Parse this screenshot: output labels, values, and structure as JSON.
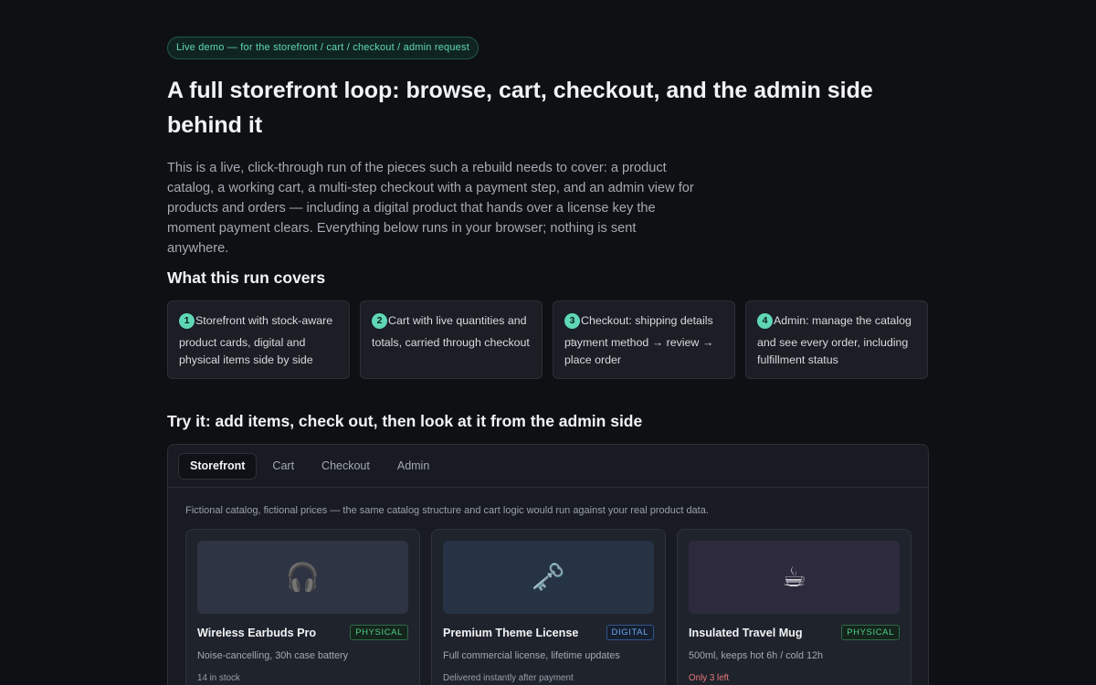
{
  "badge_text": "Live demo — for the storefront / cart / checkout / admin request",
  "title": "A full storefront loop: browse, cart, checkout, and the admin side behind it",
  "intro": "This is a live, click-through run of the pieces such a rebuild needs to cover: a product catalog, a working cart, a multi-step checkout with a payment step, and an admin view for products and orders — including a digital product that hands over a license key the moment payment clears. Everything below runs in your browser; nothing is sent anywhere.",
  "covers": {
    "heading": "What this run covers",
    "steps": [
      {
        "num": "1",
        "first": "Storefront with stock-aware",
        "rest": "product cards, digital and physical items side by side"
      },
      {
        "num": "2",
        "first": "Cart with live quantities and",
        "rest": "totals, carried through checkout"
      },
      {
        "num": "3",
        "first": "Checkout: shipping details →",
        "rest": "payment method → review → place order"
      },
      {
        "num": "4",
        "first": "Admin: manage the catalog",
        "rest": "and see every order, including fulfillment status"
      }
    ]
  },
  "try_heading": "Try it: add items, check out, then look at it from the admin side",
  "tabs": [
    "Storefront",
    "Cart",
    "Checkout",
    "Admin"
  ],
  "active_tab": "Storefront",
  "catalog_note": "Fictional catalog, fictional prices — the same catalog structure and cart logic would run against your real product data.",
  "products": [
    {
      "icon": "headphones-icon",
      "glyph": "🎧",
      "thumb_color": "#2f3444",
      "name": "Wireless Earbuds Pro",
      "type": "PHYSICAL",
      "desc": "Noise-cancelling, 30h case battery",
      "stock": "14 in stock"
    },
    {
      "icon": "key-icon",
      "glyph": "🗝️",
      "thumb_color": "#263344",
      "name": "Premium Theme License",
      "type": "DIGITAL",
      "desc": "Full commercial license, lifetime updates",
      "stock": "Delivered instantly after payment"
    },
    {
      "icon": "coffee-cup-icon",
      "glyph": "☕",
      "thumb_color": "#2e2a3e",
      "name": "Insulated Travel Mug",
      "type": "PHYSICAL",
      "desc": "500ml, keeps hot 6h / cold 12h",
      "stock": "Only 3 left"
    }
  ],
  "colors": {
    "accent": "#5fd7b7",
    "low_stock": "#e5787a",
    "physical": "#4fce86",
    "digital": "#6aa6f2"
  }
}
